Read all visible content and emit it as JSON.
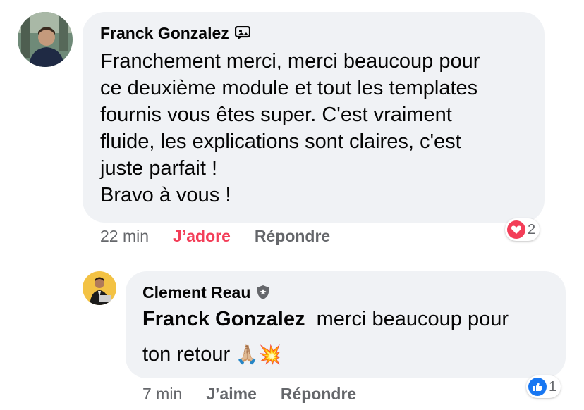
{
  "comment": {
    "author": "Franck Gonzalez",
    "author_badge_icon": "sticker-icon",
    "text": "Franchement merci, merci beaucoup pour\nce deuxième module et tout les templates\nfournis vous êtes super. C'est vraiment\nfluide, les explications sont claires, c'est\njuste parfait !\nBravo à vous !",
    "time": "22 min",
    "reaction_label": "J’adore",
    "reply_label": "Répondre",
    "reaction_count": "2",
    "reaction_icon": "heart-icon",
    "reaction_color": "#f33e58"
  },
  "reply": {
    "author": "Clement Reau",
    "author_badge_icon": "admin-shield-icon",
    "mention": "Franck Gonzalez",
    "text_line1": "merci beaucoup pour",
    "text_line2": "ton retour",
    "emojis": "🙏🏼💥",
    "time": "7 min",
    "like_label": "J’aime",
    "reply_label": "Répondre",
    "reaction_count": "1",
    "reaction_icon": "like-icon",
    "reaction_color": "#1877f2"
  }
}
